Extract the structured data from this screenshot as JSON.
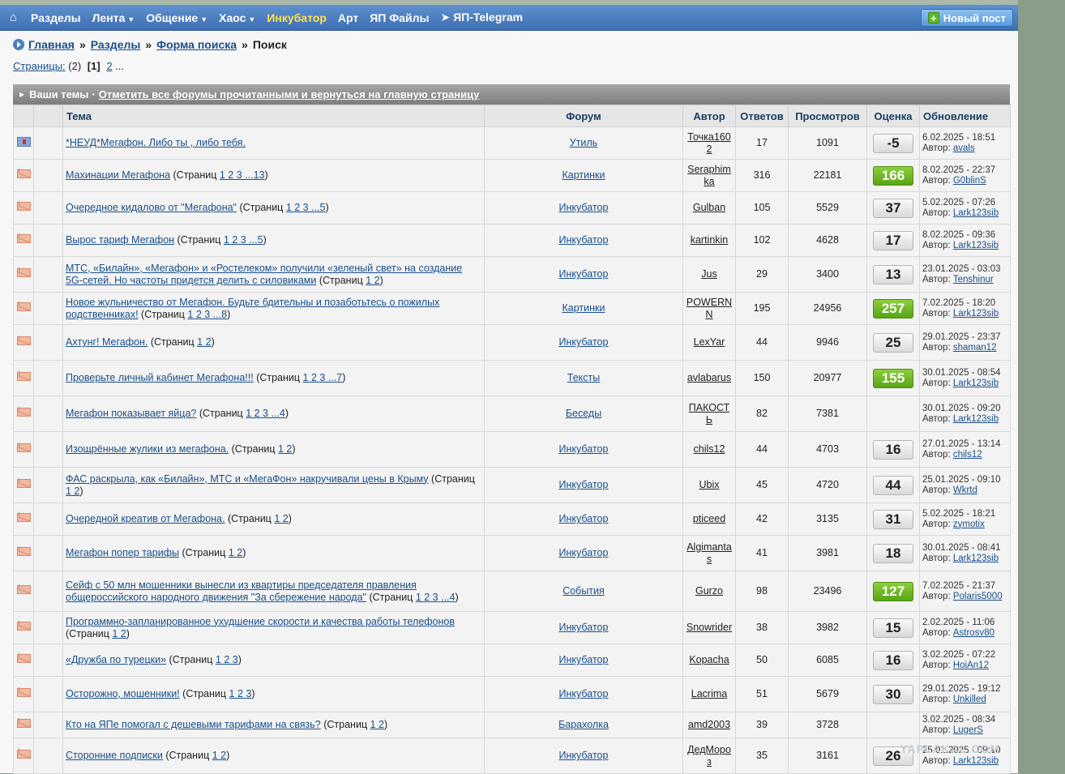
{
  "nav": {
    "home_icon": "home-icon",
    "items": [
      "Разделы",
      "Лента",
      "Общение",
      "Хаос",
      "Инкубатор",
      "Арт",
      "ЯП Файлы",
      "ЯП-Telegram"
    ],
    "new_post": "Новый пост"
  },
  "breadcrumb": {
    "home": "Главная",
    "sections": "Разделы",
    "search_form": "Форма поиска",
    "current": "Поиск",
    "sep": "»"
  },
  "pages": {
    "label": "Страницы:",
    "count": "(2)",
    "current": "[1]",
    "next": "2",
    "more": "..."
  },
  "table": {
    "your_topics": "Ваши темы",
    "dot": "·",
    "mark_read": "Отметить все форумы прочитанными и вернуться на главную страницу",
    "columns": [
      "Тема",
      "Форум",
      "Автор",
      "Ответов",
      "Просмотров",
      "Оценка",
      "Обновление"
    ],
    "author_prefix": "Автор:",
    "pages_word": "(Страниц",
    "rows": [
      {
        "icon": "flag",
        "title": "*НЕУД*Мегафон. Либо ты , либо тебя.",
        "pages": "",
        "forum": "Утиль",
        "author": "Точка1602",
        "replies": "17",
        "views": "1091",
        "rating": "-5",
        "hot": false,
        "date": "6.02.2025 - 18:51",
        "last": "avals"
      },
      {
        "icon": "env",
        "title": "Махинации Мегафона",
        "pages": "1 2 3 ...13",
        "forum": "Картинки",
        "author": "Seraphimka",
        "replies": "316",
        "views": "22181",
        "rating": "166",
        "hot": true,
        "date": "8.02.2025 - 22:37",
        "last": "G0blinS"
      },
      {
        "icon": "env",
        "title": "Очередное кидалово от \"Мегафона\"",
        "pages": "1 2 3 ...5",
        "forum": "Инкубатор",
        "author": "Gulban",
        "replies": "105",
        "views": "5529",
        "rating": "37",
        "hot": false,
        "date": "5.02.2025 - 07:26",
        "last": "Lark123sib"
      },
      {
        "icon": "env",
        "title": "Вырос тариф Мегафон",
        "pages": "1 2 3 ...5",
        "forum": "Инкубатор",
        "author": "kartinkin",
        "replies": "102",
        "views": "4628",
        "rating": "17",
        "hot": false,
        "date": "8.02.2025 - 09:36",
        "last": "Lark123sib"
      },
      {
        "icon": "env",
        "title": "МТС, «Билайн», «Мегафон» и «Ростелеком» получили «зеленый свет» на создание 5G-сетей. Но частоты придется делить с силовиками",
        "pages": "1 2",
        "forum": "Инкубатор",
        "author": "Jus",
        "replies": "29",
        "views": "3400",
        "rating": "13",
        "hot": false,
        "date": "23.01.2025 - 03:03",
        "last": "Tenshinur"
      },
      {
        "icon": "env",
        "title": "Новое жульничество от Мегафон. Будьте бдительны и позаботьтесь о пожилых родственниках!",
        "pages": "1 2 3 ...8",
        "forum": "Картинки",
        "author": "POWERNN",
        "replies": "195",
        "views": "24956",
        "rating": "257",
        "hot": true,
        "date": "7.02.2025 - 18:20",
        "last": "Lark123sib"
      },
      {
        "icon": "env",
        "title": "Ахтунг! Мегафон.",
        "pages": "1 2",
        "forum": "Инкубатор",
        "author": "LexYar",
        "replies": "44",
        "views": "9946",
        "rating": "25",
        "hot": false,
        "date": "29.01.2025 - 23:37",
        "last": "shaman12"
      },
      {
        "icon": "env",
        "title": "Проверьте личный кабинет Мегафона!!!",
        "pages": "1 2 3 ...7",
        "forum": "Тексты",
        "author": "avlabarus",
        "replies": "150",
        "views": "20977",
        "rating": "155",
        "hot": true,
        "date": "30.01.2025 - 08:54",
        "last": "Lark123sib"
      },
      {
        "icon": "env",
        "title": "Мегафон показывает яйца?",
        "pages": "1 2 3 ...4",
        "forum": "Беседы",
        "author": "ПАКОСТЬ",
        "replies": "82",
        "views": "7381",
        "rating": "",
        "hot": false,
        "date": "30.01.2025 - 09:20",
        "last": "Lark123sib"
      },
      {
        "icon": "env",
        "title": "Изощрённые жулики из мегафона.",
        "pages": "1 2",
        "forum": "Инкубатор",
        "author": "chils12",
        "replies": "44",
        "views": "4703",
        "rating": "16",
        "hot": false,
        "date": "27.01.2025 - 13:14",
        "last": "chils12"
      },
      {
        "icon": "env",
        "title": "ФАС раскрыла, как «Билайн», МТС и «МегаФон» накручивали цены в Крыму",
        "pages": "1 2",
        "forum": "Инкубатор",
        "author": "Ubix",
        "replies": "45",
        "views": "4720",
        "rating": "44",
        "hot": false,
        "date": "25.01.2025 - 09:10",
        "last": "Wkrtd"
      },
      {
        "icon": "env",
        "title": "Очередной креатив от Мегафона.",
        "pages": "1 2",
        "forum": "Инкубатор",
        "author": "pticeed",
        "replies": "42",
        "views": "3135",
        "rating": "31",
        "hot": false,
        "date": "5.02.2025 - 18:21",
        "last": "zymotix"
      },
      {
        "icon": "env",
        "title": "Мегафон попер тарифы",
        "pages": "1 2",
        "forum": "Инкубатор",
        "author": "Algimantas",
        "replies": "41",
        "views": "3981",
        "rating": "18",
        "hot": false,
        "date": "30.01.2025 - 08:41",
        "last": "Lark123sib"
      },
      {
        "icon": "env",
        "title": "Сейф с 50 млн мошенники вынесли из квартиры председателя правления общероссийского народного движения \"За сбережение народа\"",
        "pages": "1 2 3 ...4",
        "forum": "События",
        "author": "Gurzo",
        "replies": "98",
        "views": "23496",
        "rating": "127",
        "hot": true,
        "date": "7.02.2025 - 21:37",
        "last": "Polaris5000"
      },
      {
        "icon": "env",
        "title": "Программно-запланированное ухудшение скорости и качества работы телефонов",
        "pages": "1 2",
        "forum": "Инкубатор",
        "author": "Snowrider",
        "replies": "38",
        "views": "3982",
        "rating": "15",
        "hot": false,
        "date": "2.02.2025 - 11:06",
        "last": "Astrosv80"
      },
      {
        "icon": "env",
        "title": "«Дружба по турецки»",
        "pages": "1 2 3",
        "forum": "Инкубатор",
        "author": "Kopacha",
        "replies": "50",
        "views": "6085",
        "rating": "16",
        "hot": false,
        "date": "3.02.2025 - 07:22",
        "last": "HoiAn12"
      },
      {
        "icon": "env",
        "title": "Осторожно, мошенники!",
        "pages": "1 2 3",
        "forum": "Инкубатор",
        "author": "Lacrima",
        "replies": "51",
        "views": "5679",
        "rating": "30",
        "hot": false,
        "date": "29.01.2025 - 19:12",
        "last": "Unkilled"
      },
      {
        "icon": "env",
        "title": "Кто на ЯПе помогал с дешевыми тарифами на связь?",
        "pages": "1 2",
        "forum": "Барахолка",
        "author": "amd2003",
        "replies": "39",
        "views": "3728",
        "rating": "",
        "hot": false,
        "date": "3.02.2025 - 08:34",
        "last": "LugerS"
      },
      {
        "icon": "env",
        "title": "Сторонние подписки",
        "pages": "1 2",
        "forum": "Инкубатор",
        "author": "ДедМороз",
        "replies": "35",
        "views": "3161",
        "rating": "26",
        "hot": false,
        "date": "25.01.2025 - 09:10",
        "last": "Lark123sib"
      }
    ]
  },
  "watermark": "YAPLAKAL.COM"
}
